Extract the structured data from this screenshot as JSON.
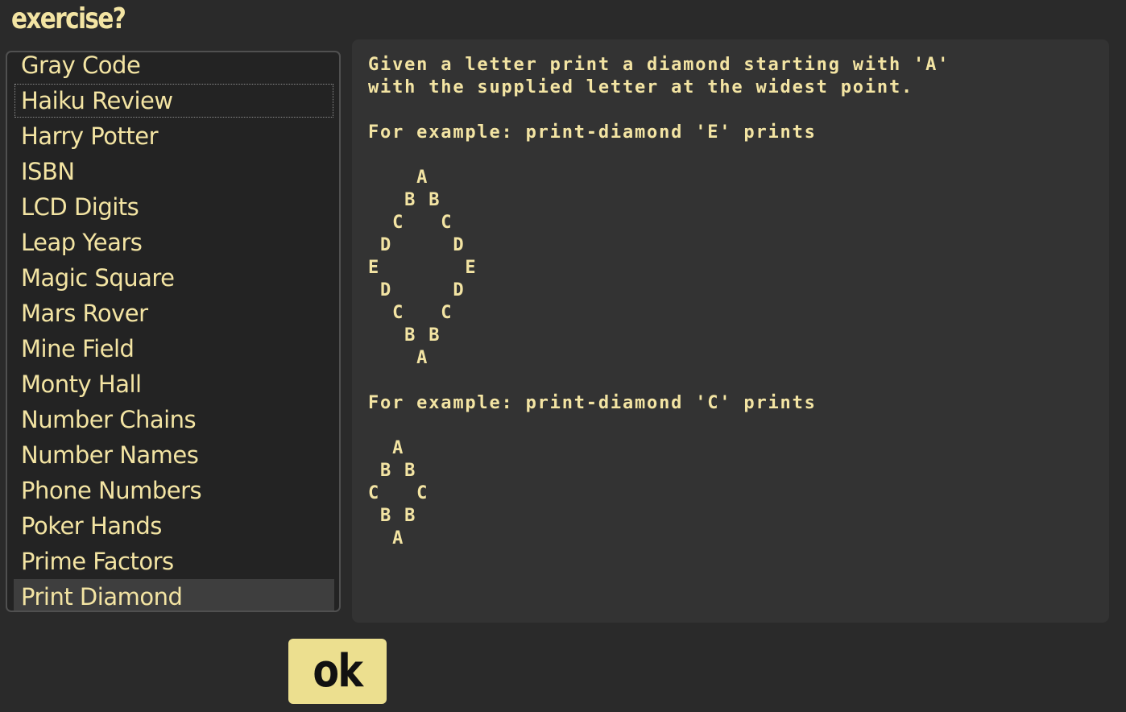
{
  "heading": "exercise?",
  "exercises": [
    {
      "label": "Gray Code"
    },
    {
      "label": "Haiku Review"
    },
    {
      "label": "Harry Potter"
    },
    {
      "label": "ISBN"
    },
    {
      "label": "LCD Digits"
    },
    {
      "label": "Leap Years"
    },
    {
      "label": "Magic Square"
    },
    {
      "label": "Mars Rover"
    },
    {
      "label": "Mine Field"
    },
    {
      "label": "Monty Hall"
    },
    {
      "label": "Number Chains"
    },
    {
      "label": "Number Names"
    },
    {
      "label": "Phone Numbers"
    },
    {
      "label": "Poker Hands"
    },
    {
      "label": "Prime Factors"
    },
    {
      "label": "Print Diamond"
    }
  ],
  "focused_exercise": "Haiku Review",
  "selected_exercise": "Print Diamond",
  "description": "Given a letter print a diamond starting with 'A'\nwith the supplied letter at the widest point.\n\nFor example: print-diamond 'E' prints\n\n    A\n   B B\n  C   C\n D     D\nE       E\n D     D\n  C   C\n   B B\n    A\n\nFor example: print-diamond 'C' prints\n\n  A\n B B\nC   C\n B B\n  A",
  "ok_label": "ok",
  "colors": {
    "background": "#2a2a2a",
    "text": "#f3e4a3",
    "panel": "#333333",
    "selected_row": "#3e3e3e",
    "ok_button": "#ecdf8f"
  }
}
